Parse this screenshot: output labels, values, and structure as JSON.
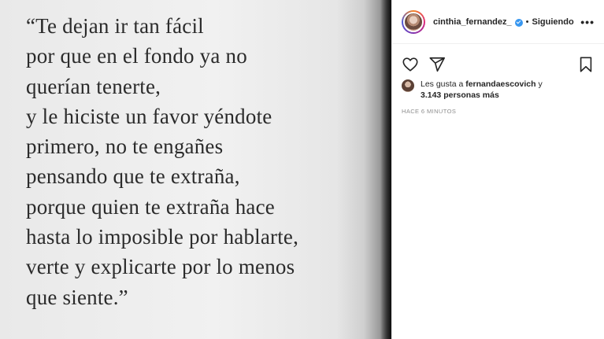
{
  "quote": {
    "lines": [
      "“Te dejan ir tan fácil",
      "por que en el fondo ya no",
      "querían tenerte,",
      "y le hiciste un favor yéndote",
      "primero, no te engañes",
      "pensando que te extraña,",
      "porque quien te extraña hace",
      "hasta lo imposible por hablarte,",
      "verte y explicarte por lo menos",
      "que siente.”"
    ]
  },
  "post": {
    "username": "cinthia_fernandez_",
    "separator": "•",
    "follow_status": "Siguiendo",
    "more_label": "•••",
    "icons": {
      "like": "heart-icon",
      "share": "send-icon",
      "save": "bookmark-icon"
    },
    "likes": {
      "prefix": "Les gusta a",
      "first_user": "fernandaescovich",
      "connector": "y",
      "others": "3.143 personas más"
    },
    "timestamp": "HACE 6 MINUTOS"
  },
  "colors": {
    "text": "#262626",
    "muted": "#8e8e8e",
    "verified": "#3897f0",
    "divider": "#efefef"
  }
}
